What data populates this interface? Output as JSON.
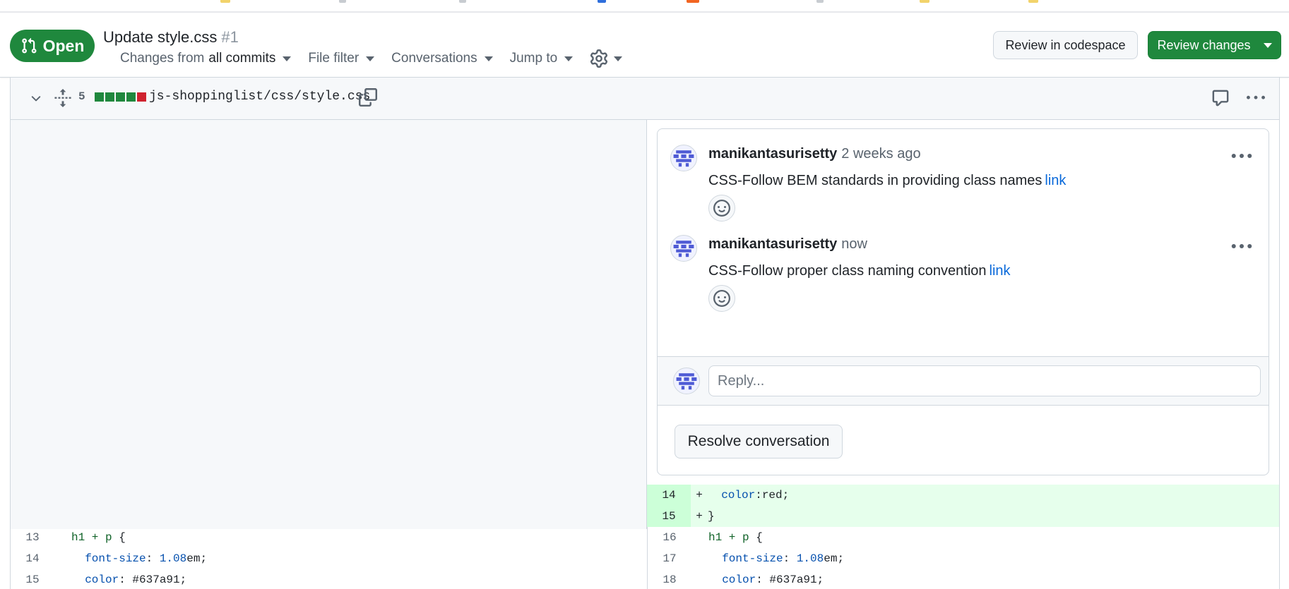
{
  "pr": {
    "state": "Open",
    "title": "Update style.css",
    "number": "#1",
    "toolbar": {
      "changes_prefix": "Changes from",
      "changes_value": "all commits",
      "file_filter": "File filter",
      "conversations": "Conversations",
      "jump_to": "Jump to"
    },
    "review_codespace": "Review in codespace",
    "review_changes": "Review changes"
  },
  "file": {
    "changes_count": "5",
    "path": "js-shoppinglist/css/style.css",
    "diffstat": [
      "added",
      "added",
      "added",
      "added",
      "deleted"
    ]
  },
  "thread": {
    "comments": [
      {
        "author": "manikantasurisetty",
        "time": "2 weeks ago",
        "body": "CSS-Follow BEM standards in providing class names",
        "link": "link"
      },
      {
        "author": "manikantasurisetty",
        "time": "now",
        "body": "CSS-Follow proper class naming convention",
        "link": "link"
      }
    ],
    "reply_placeholder": "Reply...",
    "resolve_label": "Resolve conversation"
  },
  "diff": {
    "right_added": [
      {
        "num": "14",
        "sign": "+",
        "parts": [
          [
            "",
            "  "
          ],
          [
            "prop",
            "color"
          ],
          [
            "",
            ":red;"
          ]
        ]
      },
      {
        "num": "15",
        "sign": "+",
        "parts": [
          [
            "",
            "}"
          ]
        ]
      }
    ],
    "left_context": [
      {
        "num": "13",
        "parts": [
          [
            "sel",
            "h1 + p"
          ],
          [
            "",
            " {"
          ]
        ]
      },
      {
        "num": "14",
        "parts": [
          [
            "",
            "  "
          ],
          [
            "prop",
            "font-size"
          ],
          [
            "",
            ": "
          ],
          [
            "num",
            "1.08"
          ],
          [
            "",
            "em;"
          ]
        ]
      },
      {
        "num": "15",
        "parts": [
          [
            "",
            "  "
          ],
          [
            "prop",
            "color"
          ],
          [
            "",
            ": #637a91;"
          ]
        ]
      }
    ],
    "right_context": [
      {
        "num": "16",
        "parts": [
          [
            "sel",
            "h1 + p"
          ],
          [
            "",
            " {"
          ]
        ]
      },
      {
        "num": "17",
        "parts": [
          [
            "",
            "  "
          ],
          [
            "prop",
            "font-size"
          ],
          [
            "",
            ": "
          ],
          [
            "num",
            "1.08"
          ],
          [
            "",
            "em;"
          ]
        ]
      },
      {
        "num": "18",
        "parts": [
          [
            "",
            "  "
          ],
          [
            "prop",
            "color"
          ],
          [
            "",
            ": #637a91;"
          ]
        ]
      }
    ]
  },
  "colors": {
    "open_green": "#1f883d",
    "link_blue": "#0969da",
    "added_bg": "#e6ffec",
    "added_num_bg": "#ccffd8",
    "deleted_red": "#cf222e"
  }
}
